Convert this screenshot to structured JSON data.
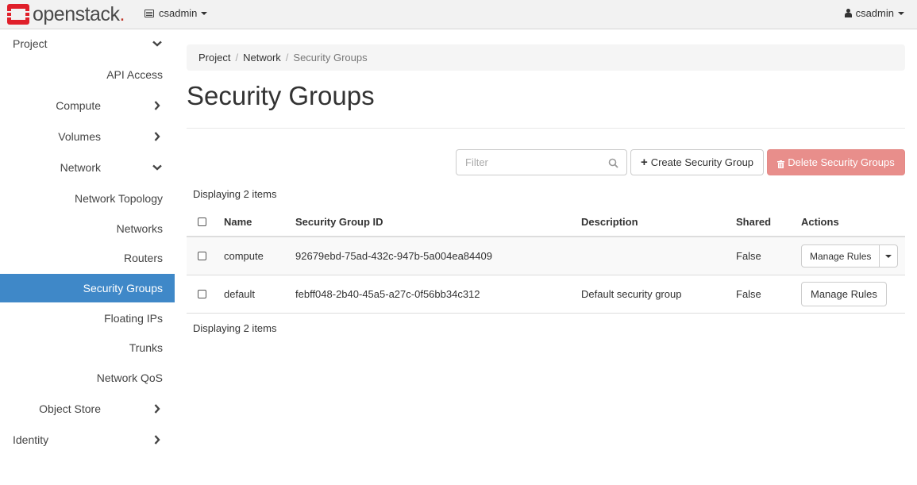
{
  "brand": {
    "name": "openstack",
    "dot": ".",
    "accent_color": "#e01f2a"
  },
  "topbar": {
    "project_selector": "csadmin",
    "user_menu": "csadmin"
  },
  "sidebar": {
    "items": [
      {
        "label": "Project",
        "level": 0,
        "chevron": "down"
      },
      {
        "label": "API Access",
        "level": 2
      },
      {
        "label": "Compute",
        "level": 1,
        "chevron": "right"
      },
      {
        "label": "Volumes",
        "level": 1,
        "chevron": "right"
      },
      {
        "label": "Network",
        "level": 1,
        "chevron": "down"
      },
      {
        "label": "Network Topology",
        "level": 2
      },
      {
        "label": "Networks",
        "level": 2
      },
      {
        "label": "Routers",
        "level": 2
      },
      {
        "label": "Security Groups",
        "level": 2,
        "active": true
      },
      {
        "label": "Floating IPs",
        "level": 2
      },
      {
        "label": "Trunks",
        "level": 2
      },
      {
        "label": "Network QoS",
        "level": 2
      },
      {
        "label": "Object Store",
        "level": 1,
        "chevron": "right"
      },
      {
        "label": "Identity",
        "level": 0,
        "chevron": "right"
      }
    ],
    "active_color": "#3f88c8"
  },
  "breadcrumb": {
    "items": [
      "Project",
      "Network"
    ],
    "separator": "/",
    "current": "Security Groups"
  },
  "page": {
    "title": "Security Groups"
  },
  "toolbar": {
    "filter_placeholder": "Filter",
    "create_label": "Create Security Group",
    "delete_label": "Delete Security Groups",
    "delete_color": "#e88e8b"
  },
  "table": {
    "count_text": "Displaying 2 items",
    "columns": [
      "Name",
      "Security Group ID",
      "Description",
      "Shared",
      "Actions"
    ],
    "rows": [
      {
        "name": "compute",
        "id": "92679ebd-75ad-432c-947b-5a004ea84409",
        "description": "",
        "shared": "False",
        "action": "Manage Rules",
        "has_dropdown": true
      },
      {
        "name": "default",
        "id": "febff048-2b40-45a5-a27c-0f56bb34c312",
        "description": "Default security group",
        "shared": "False",
        "action": "Manage Rules",
        "has_dropdown": false
      }
    ]
  }
}
